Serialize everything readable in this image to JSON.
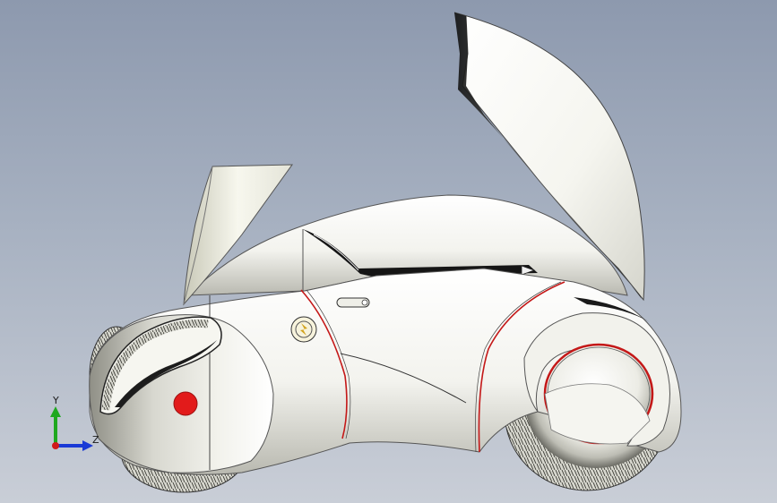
{
  "triad": {
    "y_label": "Y",
    "z_label": "Z"
  },
  "colors": {
    "background_top": "#8d99ae",
    "background_bottom": "#c9ced7",
    "body_white": "#f4f4ef",
    "accent_red": "#e21b1b",
    "y_axis": "#1fa81f",
    "z_axis": "#1a3ad6",
    "origin": "#d11a1a"
  }
}
